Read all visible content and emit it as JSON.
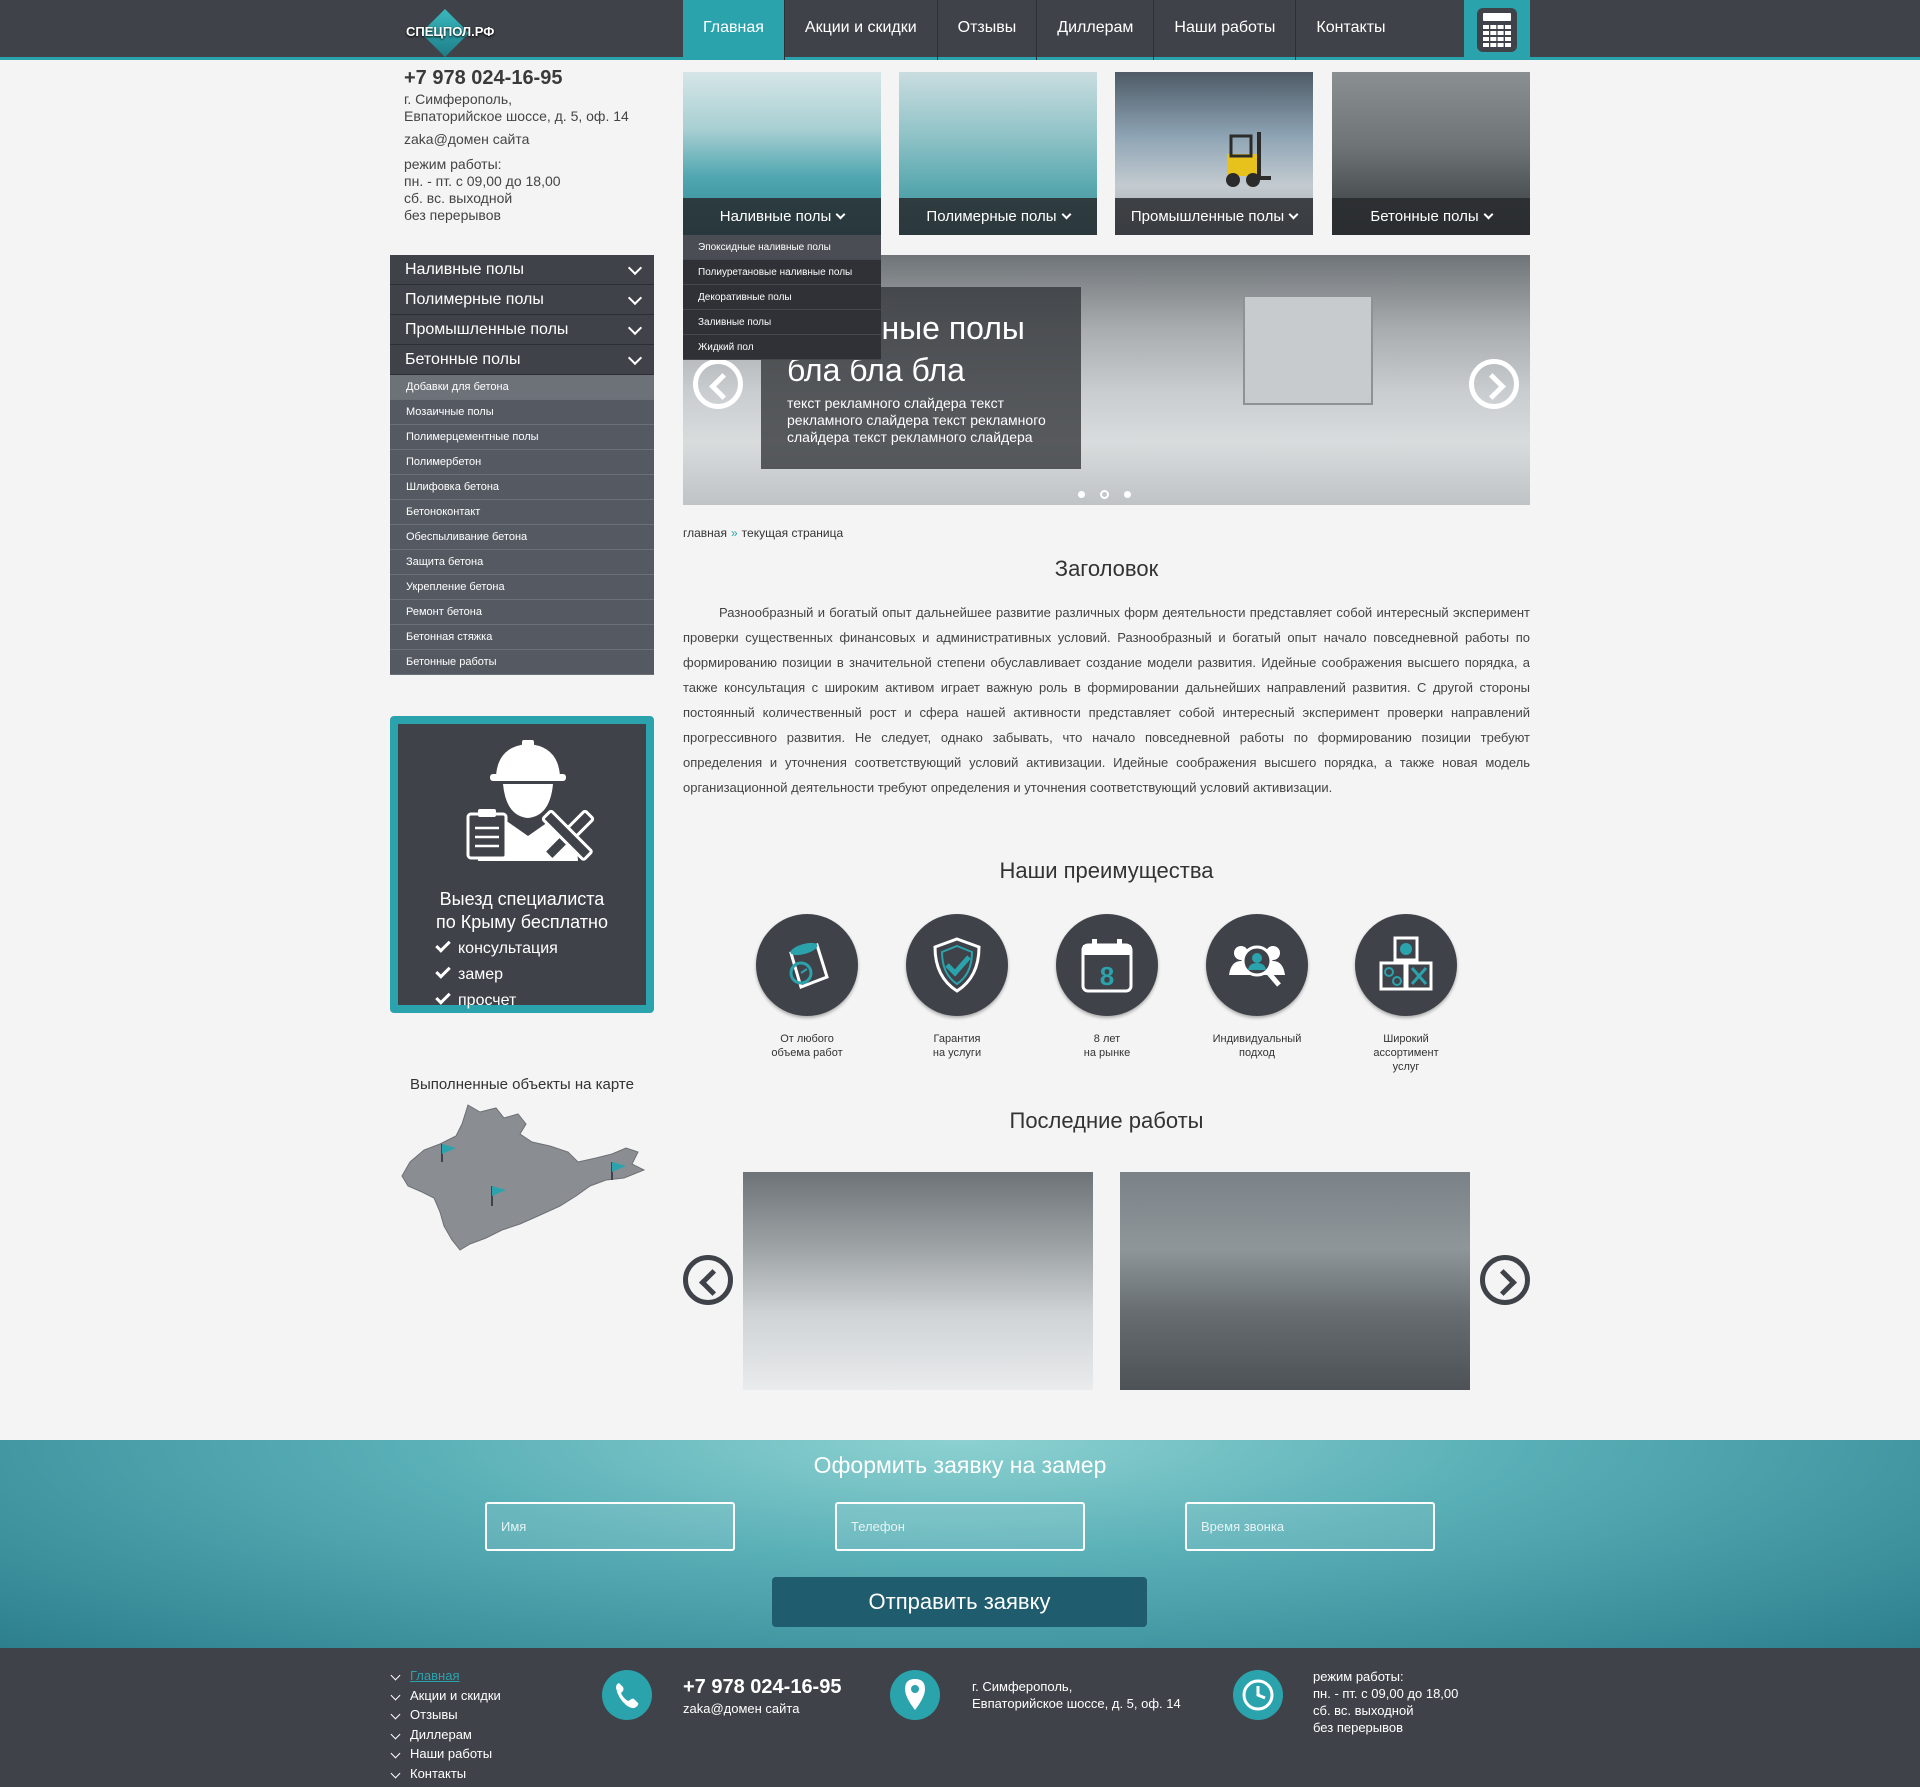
{
  "header": {
    "logo_text": "СПЕЦПОЛ.РФ",
    "nav": [
      "Главная",
      "Акции и скидки",
      "Отзывы",
      "Диллерам",
      "Наши работы",
      "Контакты"
    ],
    "active_index": 0,
    "calculator_icon": "calculator-icon"
  },
  "contact": {
    "phone": "+7 978 024-16-95",
    "address_line1": "г. Симферополь,",
    "address_line2": "Евпаторийское шоссе, д. 5, оф. 14",
    "email": "zaka@домен сайта",
    "hours_title": "режим работы:",
    "hours_line1": "пн. - пт. с 09,00 до 18,00",
    "hours_line2": "сб. вс. выходной",
    "hours_line3": "без перерывов"
  },
  "sidebar": {
    "top_items": [
      "Наливные полы",
      "Полимерные полы",
      "Промышленные полы",
      "Бетонные полы"
    ],
    "sub_items": [
      "Добавки для бетона",
      "Мозаичные полы",
      "Полимерцементные полы",
      "Полимербетон",
      "Шлифовка бетона",
      "Бетоноконтакт",
      "Обеспыливание бетона",
      "Защита бетона",
      "Укрепление бетона",
      "Ремонт бетона",
      "Бетонная стяжка",
      "Бетонные работы"
    ]
  },
  "specialist": {
    "title_line1": "Выезд специалиста",
    "title_line2": "по Крыму бесплатно",
    "list": [
      "консультация",
      "замер",
      "просчет"
    ]
  },
  "map": {
    "title": "Выполненные объекты на карте"
  },
  "tiles": [
    "Наливные полы",
    "Полимерные полы",
    "Промышленные полы",
    "Бетонные полы"
  ],
  "dropdown": [
    "Эпоксидные наливные полы",
    "Полиуретановые наливные полы",
    "Декоративные полы",
    "Заливные полы",
    "Жидкий пол"
  ],
  "slider": {
    "title_line1": "Наливные полы",
    "title_line2": "бла бла бла",
    "text": "текст рекламного слайдера текст рекламного слайдера текст рекламного слайдера текст рекламного слайдера"
  },
  "breadcrumb": {
    "home": "главная",
    "sep": "»",
    "current": "текущая страница"
  },
  "article": {
    "heading": "Заголовок",
    "body": "Разнообразный и богатый опыт дальнейшее развитие различных форм деятельности представляет собой интересный эксперимент проверки существенных финансовых и административных условий. Разнообразный и богатый опыт начало повседневной работы по формированию позиции в значительной степени обуславливает создание модели развития. Идейные соображения высшего порядка, а также консультация с широким активом играет важную роль в формировании дальнейших направлений развития. С другой стороны постоянный количественный рост и сфера нашей активности представляет собой интересный эксперимент проверки направлений прогрессивного развития. Не следует, однако забывать, что начало повседневной работы по формированию позиции требуют определения и уточнения соответствующий условий активизации. Идейные соображения высшего порядка, а также новая модель организационной деятельности требуют определения и уточнения соответствующий условий активизации."
  },
  "advantages": {
    "heading": "Наши преимущества",
    "items": [
      {
        "line1": "От любого",
        "line2": "объема работ",
        "line3": "",
        "icon": "paint-bucket-icon"
      },
      {
        "line1": "Гарантия",
        "line2": "на услуги",
        "line3": "",
        "icon": "shield-check-icon"
      },
      {
        "line1": "8 лет",
        "line2": "на рынке",
        "line3": "",
        "icon": "calendar-icon"
      },
      {
        "line1": "Индивидуальный",
        "line2": "подход",
        "line3": "",
        "icon": "person-search-icon"
      },
      {
        "line1": "Широкий",
        "line2": "ассортимент",
        "line3": "услуг",
        "icon": "boxes-icon"
      }
    ],
    "calendar_number": "8"
  },
  "works": {
    "heading": "Последние работы"
  },
  "form": {
    "title": "Оформить заявку на замер",
    "name_placeholder": "Имя",
    "phone_placeholder": "Телефон",
    "time_placeholder": "Время звонка",
    "submit": "Отправить заявку"
  },
  "footer": {
    "nav": [
      "Главная",
      "Акции и скидки",
      "Отзывы",
      "Диллерам",
      "Наши работы",
      "Контакты"
    ],
    "phone": "+7 978 024-16-95",
    "email": "zaka@домен сайта",
    "address_line1": "г. Симферополь,",
    "address_line2": "Евпаторийское шоссе, д. 5, оф. 14",
    "hours_title": "режим работы:",
    "hours_line1": "пн. - пт. с 09,00 до 18,00",
    "hours_line2": "сб. вс. выходной",
    "hours_line3": "без перерывов"
  },
  "colors": {
    "accent": "#2ba3ad",
    "dark": "#3f4249",
    "button": "#1f5c6e"
  }
}
